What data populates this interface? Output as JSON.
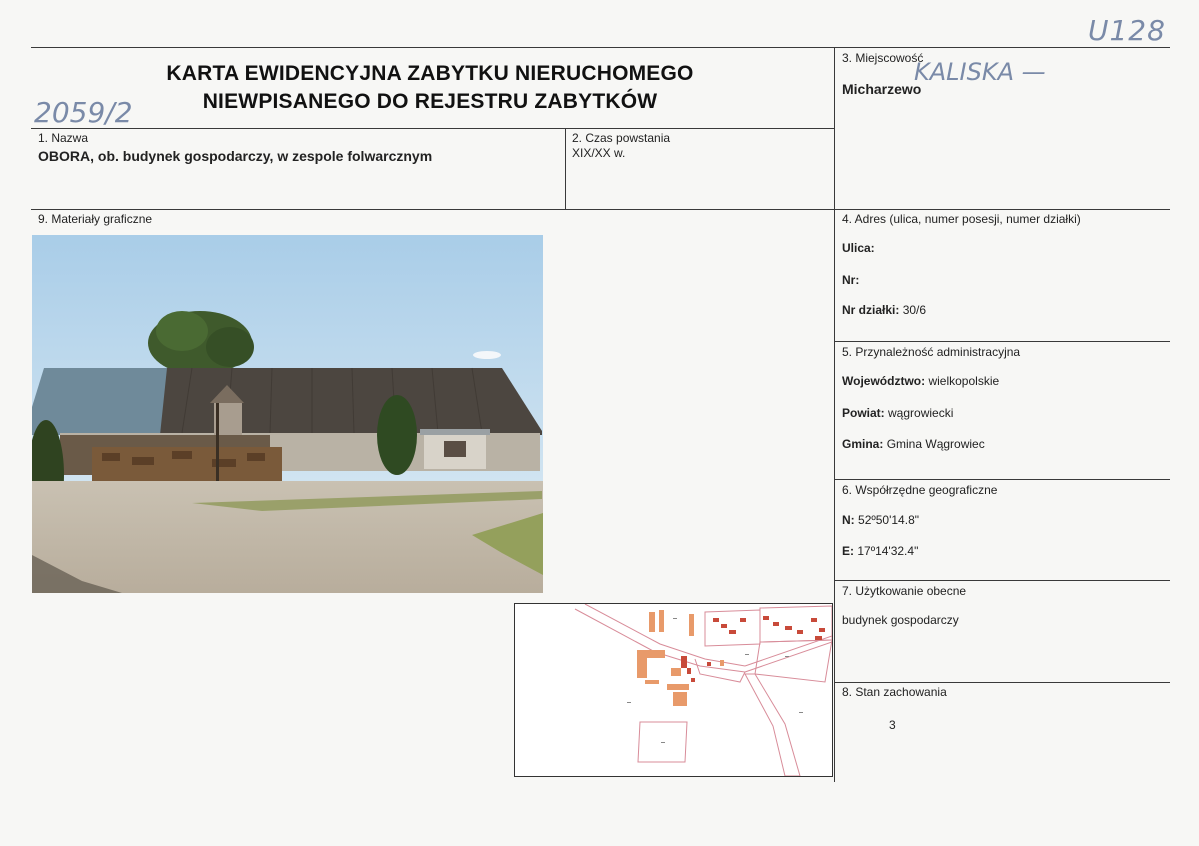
{
  "handwritten": {
    "top_right": "U128",
    "ref_number": "2059/2",
    "place_note": "KALISKA —"
  },
  "header": {
    "title_line1": "KARTA EWIDENCYJNA ZABYTKU NIERUCHOMEGO",
    "title_line2": "NIEWPISANEGO DO REJESTRU ZABYTKÓW"
  },
  "sections": {
    "nazwa": {
      "label": "1. Nazwa",
      "value": "OBORA, ob. budynek gospodarczy, w zespole folwarcznym"
    },
    "czas": {
      "label": "2. Czas powstania",
      "value": "XIX/XX w."
    },
    "miejscowosc": {
      "label": "3. Miejscowość",
      "value": "Micharzewo"
    },
    "adres": {
      "label": "4. Adres (ulica, numer posesji, numer działki)",
      "ulica_key": "Ulica:",
      "ulica_val": "",
      "nr_key": "Nr:",
      "nr_val": "",
      "dzialka_key": "Nr działki:",
      "dzialka_val": "30/6"
    },
    "administracja": {
      "label": "5. Przynależność administracyjna",
      "woj_key": "Województwo:",
      "woj_val": "wielkopolskie",
      "powiat_key": "Powiat:",
      "powiat_val": "wągrowiecki",
      "gmina_key": "Gmina:",
      "gmina_val": "Gmina Wągrowiec"
    },
    "wspolrzedne": {
      "label": "6. Współrzędne geograficzne",
      "n_key": "N:",
      "n_val": "52º50'14.8\"",
      "e_key": "E:",
      "e_val": "17º14'32.4\""
    },
    "uzytkowanie": {
      "label": "7. Użytkowanie obecne",
      "value": "budynek gospodarczy"
    },
    "stan": {
      "label": "8. Stan zachowania",
      "value": "3"
    },
    "materialy": {
      "label": "9. Materiały graficzne"
    }
  },
  "colors": {
    "map_building": "#c84a3a",
    "map_building_alt": "#e89a6a",
    "map_parcel_line": "#d88c99"
  }
}
